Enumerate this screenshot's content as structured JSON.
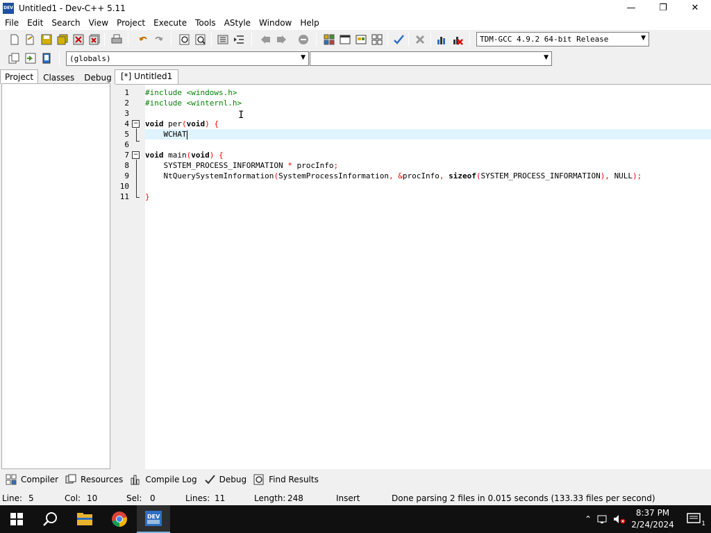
{
  "window": {
    "title": "Untitled1 - Dev-C++ 5.11",
    "app_icon_text": "DEV",
    "minimize": "—",
    "maximize": "❐",
    "close": "✕"
  },
  "menu": [
    "File",
    "Edit",
    "Search",
    "View",
    "Project",
    "Execute",
    "Tools",
    "AStyle",
    "Window",
    "Help"
  ],
  "toolbar": {
    "compiler_select": "TDM-GCC 4.9.2 64-bit Release",
    "scope_select": "(globals)",
    "member_select": ""
  },
  "left_panel": {
    "tabs": [
      "Project",
      "Classes",
      "Debug"
    ],
    "active_tab": "Project"
  },
  "editor": {
    "tab_label": "[*] Untitled1",
    "lines": [
      {
        "n": "1"
      },
      {
        "n": "2"
      },
      {
        "n": "3"
      },
      {
        "n": "4"
      },
      {
        "n": "5"
      },
      {
        "n": "6"
      },
      {
        "n": "7"
      },
      {
        "n": "8"
      },
      {
        "n": "9"
      },
      {
        "n": "10"
      },
      {
        "n": "11"
      }
    ],
    "code": {
      "l1_a": "#include ",
      "l1_b": "<windows.h>",
      "l2_a": "#include ",
      "l2_b": "<winternl.h>",
      "l4_kw1": "void",
      "l4_name": " per",
      "l4_p1": "(",
      "l4_kw2": "void",
      "l4_p2": ") {",
      "l5_text": "    WCHAT",
      "l7_kw1": "void",
      "l7_name": " main",
      "l7_p1": "(",
      "l7_kw2": "void",
      "l7_p2": ") {",
      "l8_a": "    SYSTEM_PROCESS_INFORMATION ",
      "l8_b": "*",
      "l8_c": " procInfo",
      "l8_d": ";",
      "l9_a": "    NtQuerySystemInformation",
      "l9_b": "(",
      "l9_c": "SystemProcessInformation",
      "l9_d": ", &",
      "l9_e": "procInfo",
      "l9_f": ", ",
      "l9_g": "sizeof",
      "l9_h": "(",
      "l9_i": "SYSTEM_PROCESS_INFORMATION",
      "l9_j": "), ",
      "l9_k": "NULL",
      "l9_l": ");",
      "l11_a": "}"
    }
  },
  "bottom_tabs": [
    "Compiler",
    "Resources",
    "Compile Log",
    "Debug",
    "Find Results"
  ],
  "status": {
    "line_label": "Line:",
    "line_value": "5",
    "col_label": "Col:",
    "col_value": "10",
    "sel_label": "Sel:",
    "sel_value": "0",
    "lines_label": "Lines:",
    "lines_value": "11",
    "length_label": "Length:",
    "length_value": "248",
    "mode": "Insert",
    "message": "Done parsing 2 files in 0.015 seconds (133.33 files per second)"
  },
  "taskbar": {
    "time": "8:37 PM",
    "date": "2/24/2024",
    "notification_count": "1"
  },
  "colors": {
    "preprocessor": "#008000",
    "symbol": "#ff0000",
    "current_line": "#e0f4ff",
    "taskbar": "#101010"
  }
}
